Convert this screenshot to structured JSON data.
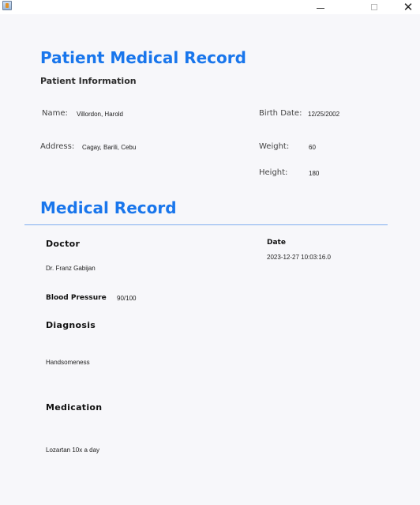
{
  "window": {
    "minimize": "−",
    "maximize": "",
    "close": "✕",
    "app_icon": "java-app-icon"
  },
  "header": {
    "title": "Patient Medical Record",
    "subtitle": "Patient Information"
  },
  "patient": {
    "name_label": "Name:",
    "name_value": "Villordon, Harold",
    "address_label": "Address:",
    "address_value": "Cagay, Barili, Cebu",
    "birth_label": "Birth Date:",
    "birth_value": "12/25/2002",
    "weight_label": "Weight:",
    "weight_value": "60",
    "height_label": "Height:",
    "height_value": "180"
  },
  "record": {
    "title": "Medical Record",
    "doctor_label": "Doctor",
    "doctor_value": "Dr. Franz Gabijan",
    "date_label": "Date",
    "date_value": "2023-12-27 10:03:16.0",
    "bp_label": "Blood Pressure",
    "bp_value": "90/100",
    "diagnosis_label": "Diagnosis",
    "diagnosis_value": "Handsomeness",
    "medication_label": "Medication",
    "medication_value": "Lozartan 10x a day"
  },
  "colors": {
    "accent": "#1976ec",
    "divider": "#7faef0",
    "background": "#f7f7fa"
  }
}
